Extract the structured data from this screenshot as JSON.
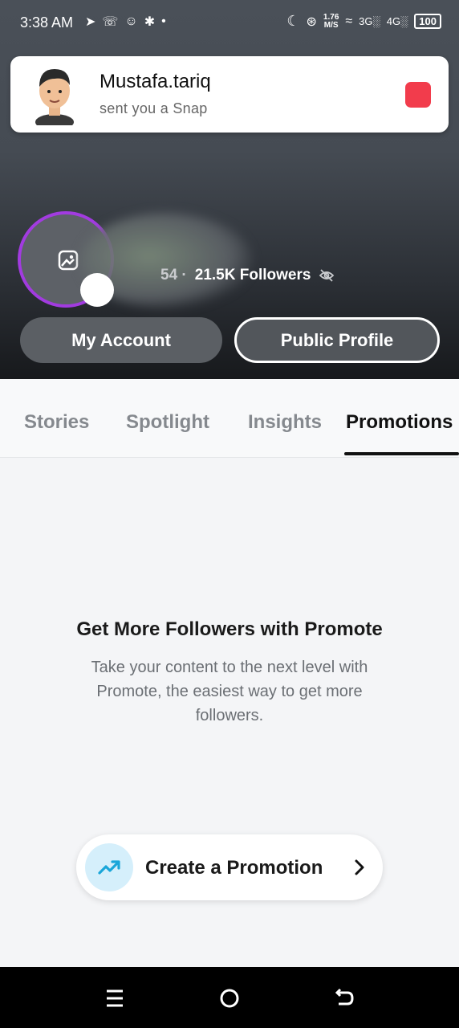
{
  "status_bar": {
    "time": "3:38 AM",
    "network_speed_value": "1.76",
    "network_speed_unit": "M/S",
    "network_3g": "3G",
    "network_4g": "4G",
    "battery": "100"
  },
  "notification": {
    "sender": "Mustafa.tariq",
    "message": "sent you a Snap",
    "badge_color": "#f23c4c"
  },
  "profile": {
    "followers_prefix": "54 ·",
    "followers_text": "21.5K Followers",
    "ring_color": "#a23be0"
  },
  "buttons": {
    "my_account": "My Account",
    "public_profile": "Public Profile"
  },
  "tabs": [
    {
      "label": "Stories",
      "active": false
    },
    {
      "label": "Spotlight",
      "active": false
    },
    {
      "label": "Insights",
      "active": false
    },
    {
      "label": "Promotions",
      "active": true
    }
  ],
  "promo": {
    "title": "Get More Followers with Promote",
    "description": "Take your content to the next level with Promote, the easiest way to get more followers.",
    "create_button": "Create a Promotion"
  },
  "icons": {
    "trend": "trending-up-icon",
    "chevron": "chevron-right-icon",
    "image": "image-icon",
    "eye_off": "eye-off-icon"
  }
}
